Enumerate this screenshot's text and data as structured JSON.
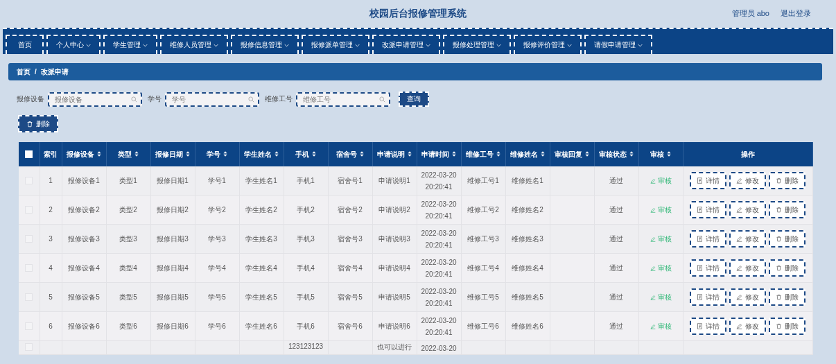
{
  "header": {
    "title": "校园后台报修管理系统",
    "user": "管理员 abo",
    "logout": "退出登录"
  },
  "nav": [
    {
      "label": "首页",
      "dropdown": false
    },
    {
      "label": "个人中心",
      "dropdown": true
    },
    {
      "label": "学生管理",
      "dropdown": true
    },
    {
      "label": "维修人员管理",
      "dropdown": true
    },
    {
      "label": "报修信息管理",
      "dropdown": true
    },
    {
      "label": "报修派单管理",
      "dropdown": true
    },
    {
      "label": "改派申请管理",
      "dropdown": true
    },
    {
      "label": "报修处理管理",
      "dropdown": true
    },
    {
      "label": "报修评价管理",
      "dropdown": true
    },
    {
      "label": "请假申请管理",
      "dropdown": true
    }
  ],
  "breadcrumb": {
    "items": [
      "首页",
      "改派申请"
    ],
    "separator": "/"
  },
  "search": {
    "fields": [
      {
        "label": "报修设备",
        "placeholder": "报修设备"
      },
      {
        "label": "学号",
        "placeholder": "学号"
      },
      {
        "label": "维修工号",
        "placeholder": "维修工号"
      }
    ],
    "button": "查询"
  },
  "delete_button": "删除",
  "table": {
    "select_all_checked": false,
    "columns": [
      {
        "label": "索引",
        "sortable": false
      },
      {
        "label": "报修设备",
        "sortable": true
      },
      {
        "label": "类型",
        "sortable": true
      },
      {
        "label": "报修日期",
        "sortable": true
      },
      {
        "label": "学号",
        "sortable": true
      },
      {
        "label": "学生姓名",
        "sortable": true
      },
      {
        "label": "手机",
        "sortable": true
      },
      {
        "label": "宿舍号",
        "sortable": true
      },
      {
        "label": "申请说明",
        "sortable": true
      },
      {
        "label": "申请时间",
        "sortable": true
      },
      {
        "label": "维修工号",
        "sortable": true
      },
      {
        "label": "维修姓名",
        "sortable": true
      },
      {
        "label": "审核回复",
        "sortable": true
      },
      {
        "label": "审核状态",
        "sortable": true
      },
      {
        "label": "审核",
        "sortable": true
      },
      {
        "label": "操作",
        "sortable": false
      }
    ],
    "rows": [
      {
        "checked": false,
        "index": "1",
        "device": "报修设备1",
        "type": "类型1",
        "date": "报修日期1",
        "student_no": "学号1",
        "student_name": "学生姓名1",
        "phone": "手机1",
        "dorm": "宿舍号1",
        "note": "申请说明1",
        "time": "2022-03-20 20:20:41",
        "worker_no": "维修工号1",
        "worker_name": "维修姓名1",
        "status": "通过",
        "review": "审核",
        "actions": [
          "详情",
          "修改",
          "删除"
        ]
      },
      {
        "checked": false,
        "index": "2",
        "device": "报修设备2",
        "type": "类型2",
        "date": "报修日期2",
        "student_no": "学号2",
        "student_name": "学生姓名2",
        "phone": "手机2",
        "dorm": "宿舍号2",
        "note": "申请说明2",
        "time": "2022-03-20 20:20:41",
        "worker_no": "维修工号2",
        "worker_name": "维修姓名2",
        "status": "通过",
        "review": "审核",
        "actions": [
          "详情",
          "修改",
          "删除"
        ]
      },
      {
        "checked": false,
        "index": "3",
        "device": "报修设备3",
        "type": "类型3",
        "date": "报修日期3",
        "student_no": "学号3",
        "student_name": "学生姓名3",
        "phone": "手机3",
        "dorm": "宿舍号3",
        "note": "申请说明3",
        "time": "2022-03-20 20:20:41",
        "worker_no": "维修工号3",
        "worker_name": "维修姓名3",
        "status": "通过",
        "review": "审核",
        "actions": [
          "详情",
          "修改",
          "删除"
        ]
      },
      {
        "checked": false,
        "index": "4",
        "device": "报修设备4",
        "type": "类型4",
        "date": "报修日期4",
        "student_no": "学号4",
        "student_name": "学生姓名4",
        "phone": "手机4",
        "dorm": "宿舍号4",
        "note": "申请说明4",
        "time": "2022-03-20 20:20:41",
        "worker_no": "维修工号4",
        "worker_name": "维修姓名4",
        "status": "通过",
        "review": "审核",
        "actions": [
          "详情",
          "修改",
          "删除"
        ]
      },
      {
        "checked": false,
        "index": "5",
        "device": "报修设备5",
        "type": "类型5",
        "date": "报修日期5",
        "student_no": "学号5",
        "student_name": "学生姓名5",
        "phone": "手机5",
        "dorm": "宿舍号5",
        "note": "申请说明5",
        "time": "2022-03-20 20:20:41",
        "worker_no": "维修工号5",
        "worker_name": "维修姓名5",
        "status": "通过",
        "review": "审核",
        "actions": [
          "详情",
          "修改",
          "删除"
        ]
      },
      {
        "checked": false,
        "index": "6",
        "device": "报修设备6",
        "type": "类型6",
        "date": "报修日期6",
        "student_no": "学号6",
        "student_name": "学生姓名6",
        "phone": "手机6",
        "dorm": "宿舍号6",
        "note": "申请说明6",
        "time": "2022-03-20 20:20:41",
        "worker_no": "维修工号6",
        "worker_name": "维修姓名6",
        "status": "通过",
        "review": "审核",
        "actions": [
          "详情",
          "修改",
          "删除"
        ]
      },
      {
        "checked": false,
        "phone": "123123123",
        "note": "也可以进行",
        "time": "2022-03-20"
      }
    ]
  }
}
